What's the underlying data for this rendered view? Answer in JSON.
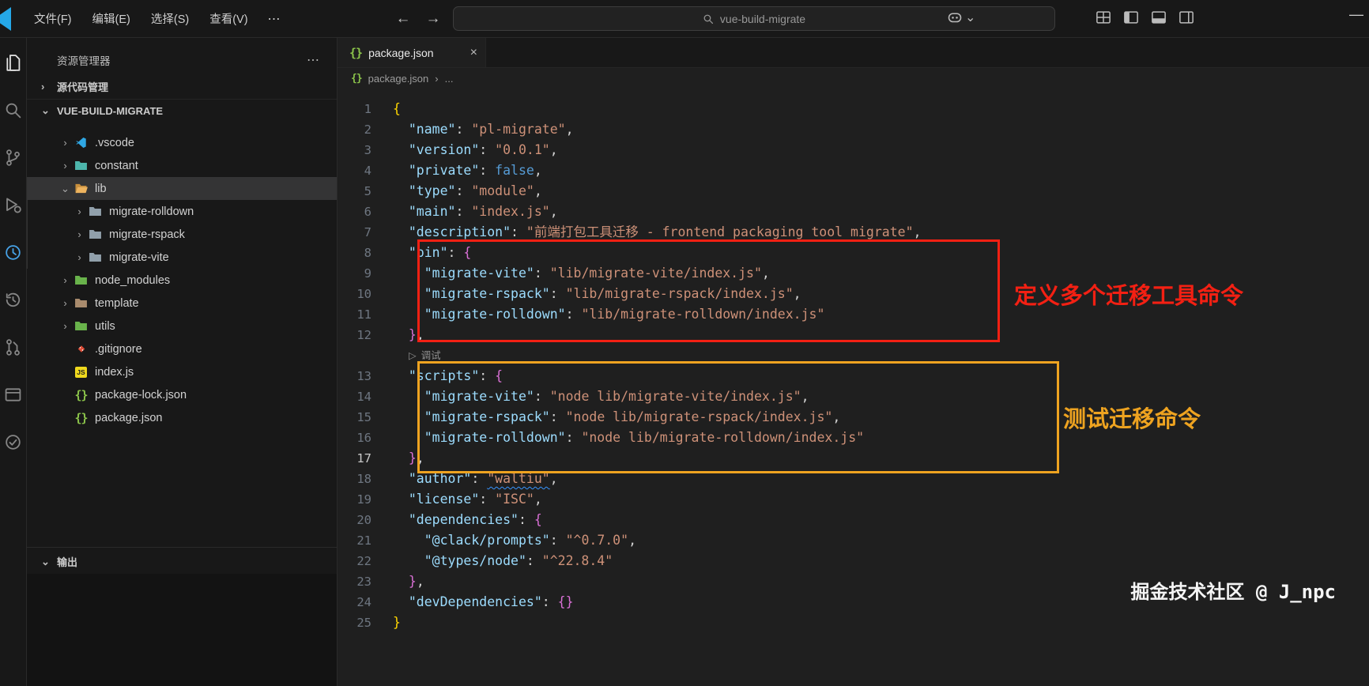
{
  "icons": {
    "chevron_down": "⌄",
    "chevron_right": "›",
    "back": "←",
    "forward": "→",
    "more": "⋯",
    "minimize": "—",
    "close": "×",
    "play": "▷",
    "breadcrumb_sep": "›"
  },
  "titlebar": {
    "menus": [
      "文件(F)",
      "编辑(E)",
      "选择(S)",
      "查看(V)"
    ],
    "search_value": "vue-build-migrate"
  },
  "activitybar": {
    "items": [
      {
        "name": "explorer-icon",
        "icon": "files",
        "active": true
      },
      {
        "name": "search-icon",
        "icon": "search"
      },
      {
        "name": "source-control-icon",
        "icon": "branch"
      },
      {
        "name": "run-debug-icon",
        "icon": "debug"
      },
      {
        "name": "timeline-icon",
        "icon": "clock",
        "accent": true
      },
      {
        "name": "history-icon",
        "icon": "history"
      },
      {
        "name": "pull-request-icon",
        "icon": "pr"
      },
      {
        "name": "panel-icon",
        "icon": "window"
      },
      {
        "name": "check-icon",
        "icon": "check"
      }
    ]
  },
  "sidebar": {
    "title": "资源管理器",
    "sections": {
      "scm": "源代码管理",
      "project": "VUE-BUILD-MIGRATE",
      "output": "输出"
    },
    "tree": [
      {
        "icon": "vscode",
        "label": ".vscode",
        "chevron": "right",
        "indent": 1
      },
      {
        "icon": "folder-teal",
        "label": "constant",
        "chevron": "right",
        "indent": 1
      },
      {
        "icon": "folder-open-orange",
        "label": "lib",
        "chevron": "down",
        "indent": 1,
        "selected": true
      },
      {
        "icon": "folder-gray",
        "label": "migrate-rolldown",
        "chevron": "right",
        "indent": 2
      },
      {
        "icon": "folder-gray",
        "label": "migrate-rspack",
        "chevron": "right",
        "indent": 2
      },
      {
        "icon": "folder-gray",
        "label": "migrate-vite",
        "chevron": "right",
        "indent": 2
      },
      {
        "icon": "folder-green",
        "label": "node_modules",
        "chevron": "right",
        "indent": 1
      },
      {
        "icon": "folder-tan",
        "label": "template",
        "chevron": "right",
        "indent": 1
      },
      {
        "icon": "folder-green",
        "label": "utils",
        "chevron": "right",
        "indent": 1
      },
      {
        "icon": "git",
        "label": ".gitignore",
        "chevron": "none",
        "indent": 1
      },
      {
        "icon": "js",
        "label": "index.js",
        "chevron": "none",
        "indent": 1
      },
      {
        "icon": "json-green",
        "label": "package-lock.json",
        "chevron": "none",
        "indent": 1
      },
      {
        "icon": "json-green",
        "label": "package.json",
        "chevron": "none",
        "indent": 1
      }
    ]
  },
  "editor": {
    "tab": {
      "label": "package.json"
    },
    "breadcrumb": {
      "file": "package.json",
      "more": "..."
    },
    "active_line": 17,
    "debug_lens": {
      "label": "调试",
      "before_line": 13
    },
    "code_lines": [
      {
        "n": 1,
        "t": [
          [
            "b1",
            "{"
          ]
        ]
      },
      {
        "n": 2,
        "t": [
          [
            "p",
            "  "
          ],
          [
            "k",
            "\"name\""
          ],
          [
            "p",
            ": "
          ],
          [
            "s",
            "\"pl-migrate\""
          ],
          [
            "p",
            ","
          ]
        ]
      },
      {
        "n": 3,
        "t": [
          [
            "p",
            "  "
          ],
          [
            "k",
            "\"version\""
          ],
          [
            "p",
            ": "
          ],
          [
            "s",
            "\"0.0.1\""
          ],
          [
            "p",
            ","
          ]
        ]
      },
      {
        "n": 4,
        "t": [
          [
            "p",
            "  "
          ],
          [
            "k",
            "\"private\""
          ],
          [
            "p",
            ": "
          ],
          [
            "w",
            "false"
          ],
          [
            "p",
            ","
          ]
        ]
      },
      {
        "n": 5,
        "t": [
          [
            "p",
            "  "
          ],
          [
            "k",
            "\"type\""
          ],
          [
            "p",
            ": "
          ],
          [
            "s",
            "\"module\""
          ],
          [
            "p",
            ","
          ]
        ]
      },
      {
        "n": 6,
        "t": [
          [
            "p",
            "  "
          ],
          [
            "k",
            "\"main\""
          ],
          [
            "p",
            ": "
          ],
          [
            "s",
            "\"index.js\""
          ],
          [
            "p",
            ","
          ]
        ]
      },
      {
        "n": 7,
        "t": [
          [
            "p",
            "  "
          ],
          [
            "k",
            "\"description\""
          ],
          [
            "p",
            ": "
          ],
          [
            "s",
            "\"前端打包工具迁移 - frontend packaging tool migrate\""
          ],
          [
            "p",
            ","
          ]
        ]
      },
      {
        "n": 8,
        "t": [
          [
            "p",
            "  "
          ],
          [
            "k",
            "\"bin\""
          ],
          [
            "p",
            ": "
          ],
          [
            "b2",
            "{"
          ]
        ]
      },
      {
        "n": 9,
        "t": [
          [
            "p",
            "    "
          ],
          [
            "k",
            "\"migrate-vite\""
          ],
          [
            "p",
            ": "
          ],
          [
            "s",
            "\"lib/migrate-vite/index.js\""
          ],
          [
            "p",
            ","
          ]
        ]
      },
      {
        "n": 10,
        "t": [
          [
            "p",
            "    "
          ],
          [
            "k",
            "\"migrate-rspack\""
          ],
          [
            "p",
            ": "
          ],
          [
            "s",
            "\"lib/migrate-rspack/index.js\""
          ],
          [
            "p",
            ","
          ]
        ]
      },
      {
        "n": 11,
        "t": [
          [
            "p",
            "    "
          ],
          [
            "k",
            "\"migrate-rolldown\""
          ],
          [
            "p",
            ": "
          ],
          [
            "s",
            "\"lib/migrate-rolldown/index.js\""
          ]
        ]
      },
      {
        "n": 12,
        "t": [
          [
            "p",
            "  "
          ],
          [
            "b2",
            "}"
          ],
          [
            "p",
            ","
          ]
        ]
      },
      {
        "n": 13,
        "t": [
          [
            "p",
            "  "
          ],
          [
            "k",
            "\"scripts\""
          ],
          [
            "p",
            ": "
          ],
          [
            "b2",
            "{"
          ]
        ]
      },
      {
        "n": 14,
        "t": [
          [
            "p",
            "    "
          ],
          [
            "k",
            "\"migrate-vite\""
          ],
          [
            "p",
            ": "
          ],
          [
            "s",
            "\"node lib/migrate-vite/index.js\""
          ],
          [
            "p",
            ","
          ]
        ]
      },
      {
        "n": 15,
        "t": [
          [
            "p",
            "    "
          ],
          [
            "k",
            "\"migrate-rspack\""
          ],
          [
            "p",
            ": "
          ],
          [
            "s",
            "\"node lib/migrate-rspack/index.js\""
          ],
          [
            "p",
            ","
          ]
        ]
      },
      {
        "n": 16,
        "t": [
          [
            "p",
            "    "
          ],
          [
            "k",
            "\"migrate-rolldown\""
          ],
          [
            "p",
            ": "
          ],
          [
            "s",
            "\"node lib/migrate-rolldown/index.js\""
          ]
        ]
      },
      {
        "n": 17,
        "t": [
          [
            "p",
            "  "
          ],
          [
            "b2",
            "}"
          ],
          [
            "p",
            ","
          ]
        ]
      },
      {
        "n": 18,
        "t": [
          [
            "p",
            "  "
          ],
          [
            "k",
            "\"author\""
          ],
          [
            "p",
            ": "
          ],
          [
            "sq",
            "\"waltiu\""
          ],
          [
            "p",
            ","
          ]
        ]
      },
      {
        "n": 19,
        "t": [
          [
            "p",
            "  "
          ],
          [
            "k",
            "\"license\""
          ],
          [
            "p",
            ": "
          ],
          [
            "s",
            "\"ISC\""
          ],
          [
            "p",
            ","
          ]
        ]
      },
      {
        "n": 20,
        "t": [
          [
            "p",
            "  "
          ],
          [
            "k",
            "\"dependencies\""
          ],
          [
            "p",
            ": "
          ],
          [
            "b2",
            "{"
          ]
        ]
      },
      {
        "n": 21,
        "t": [
          [
            "p",
            "    "
          ],
          [
            "k",
            "\"@clack/prompts\""
          ],
          [
            "p",
            ": "
          ],
          [
            "s",
            "\"^0.7.0\""
          ],
          [
            "p",
            ","
          ]
        ]
      },
      {
        "n": 22,
        "t": [
          [
            "p",
            "    "
          ],
          [
            "k",
            "\"@types/node\""
          ],
          [
            "p",
            ": "
          ],
          [
            "s",
            "\"^22.8.4\""
          ]
        ]
      },
      {
        "n": 23,
        "t": [
          [
            "p",
            "  "
          ],
          [
            "b2",
            "}"
          ],
          [
            "p",
            ","
          ]
        ]
      },
      {
        "n": 24,
        "t": [
          [
            "p",
            "  "
          ],
          [
            "k",
            "\"devDependencies\""
          ],
          [
            "p",
            ": "
          ],
          [
            "b2",
            "{}"
          ]
        ]
      },
      {
        "n": 25,
        "t": [
          [
            "b1",
            "}"
          ]
        ]
      }
    ]
  },
  "annotations": {
    "red_box_label": "定义多个迁移工具命令",
    "yellow_box_label": "测试迁移命令",
    "red_color": "#f32013",
    "yellow_color": "#eea320",
    "watermark": "掘金技术社区 @ J_npc"
  }
}
